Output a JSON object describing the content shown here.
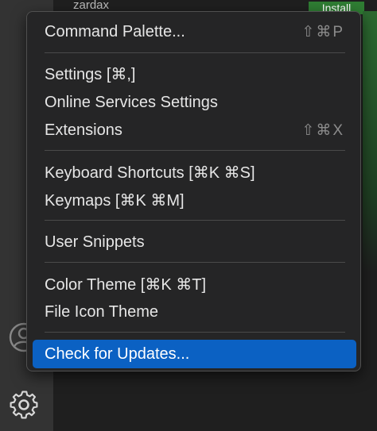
{
  "background": {
    "extension_name": "zardax",
    "install_label": "Install"
  },
  "activity_bar": {
    "account_icon": "account-icon",
    "manage_icon": "gear-icon"
  },
  "menu": {
    "items": [
      {
        "label": "Command Palette...",
        "shortcut": "⇧⌘P"
      },
      {
        "label": "Settings [⌘,]",
        "shortcut": ""
      },
      {
        "label": "Online Services Settings",
        "shortcut": ""
      },
      {
        "label": "Extensions",
        "shortcut": "⇧⌘X"
      },
      {
        "label": "Keyboard Shortcuts [⌘K ⌘S]",
        "shortcut": ""
      },
      {
        "label": "Keymaps [⌘K ⌘M]",
        "shortcut": ""
      },
      {
        "label": "User Snippets",
        "shortcut": ""
      },
      {
        "label": "Color Theme [⌘K ⌘T]",
        "shortcut": ""
      },
      {
        "label": "File Icon Theme",
        "shortcut": ""
      },
      {
        "label": "Check for Updates...",
        "shortcut": ""
      }
    ],
    "selected_index": 9
  },
  "colors": {
    "menu_background": "#252526",
    "selection": "#0b61c3",
    "install_button": "#2f7d33"
  }
}
